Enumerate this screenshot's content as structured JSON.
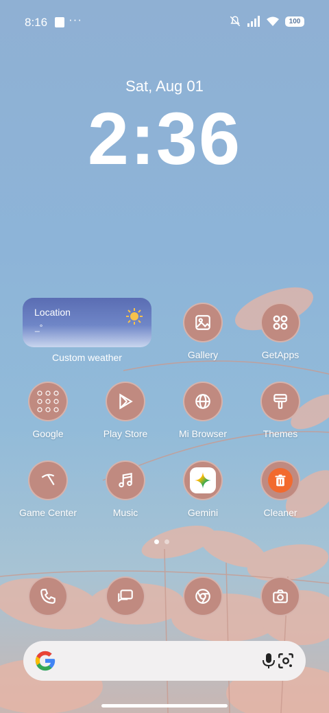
{
  "status_bar": {
    "time": "8:16",
    "battery": "100"
  },
  "lockclock": {
    "date": "Sat, Aug 01",
    "time": "2:36"
  },
  "weather_widget": {
    "location": "Location",
    "temperature": "_°",
    "label": "Custom weather"
  },
  "apps": [
    {
      "label": "Gallery",
      "icon": "gallery-icon"
    },
    {
      "label": "GetApps",
      "icon": "getapps-icon"
    },
    {
      "label": "Google",
      "icon": "google-folder-icon"
    },
    {
      "label": "Play Store",
      "icon": "play-store-icon"
    },
    {
      "label": "Mi Browser",
      "icon": "globe-icon"
    },
    {
      "label": "Themes",
      "icon": "brush-icon"
    },
    {
      "label": "Game Center",
      "icon": "game-icon"
    },
    {
      "label": "Music",
      "icon": "music-note-icon"
    },
    {
      "label": "Gemini",
      "icon": "gemini-icon"
    },
    {
      "label": "Cleaner",
      "icon": "trash-icon"
    }
  ],
  "dock": [
    {
      "icon": "phone-icon"
    },
    {
      "icon": "messages-icon"
    },
    {
      "icon": "chrome-icon"
    },
    {
      "icon": "camera-icon"
    }
  ],
  "colors": {
    "icon_bg": "#c08a80",
    "cleaner_accent": "#f26a2e"
  }
}
